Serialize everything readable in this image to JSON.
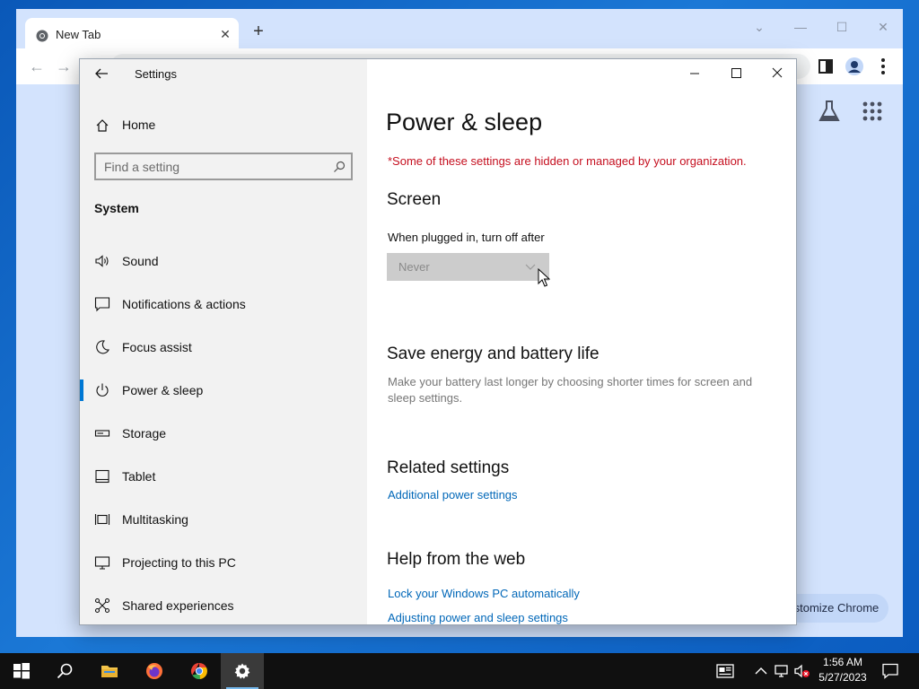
{
  "chrome": {
    "tab_title": "New Tab",
    "customize_label": "Customize Chrome"
  },
  "settings": {
    "app_title": "Settings",
    "home_label": "Home",
    "search_placeholder": "Find a setting",
    "section_title": "System",
    "nav_items": [
      {
        "label": "Sound",
        "icon": "speaker-icon"
      },
      {
        "label": "Notifications & actions",
        "icon": "notification-icon"
      },
      {
        "label": "Focus assist",
        "icon": "moon-icon"
      },
      {
        "label": "Power & sleep",
        "icon": "power-icon",
        "active": true
      },
      {
        "label": "Storage",
        "icon": "storage-icon"
      },
      {
        "label": "Tablet",
        "icon": "tablet-icon"
      },
      {
        "label": "Multitasking",
        "icon": "multitasking-icon"
      },
      {
        "label": "Projecting to this PC",
        "icon": "projecting-icon"
      },
      {
        "label": "Shared experiences",
        "icon": "shared-experiences-icon"
      }
    ],
    "page": {
      "title": "Power & sleep",
      "org_notice": "*Some of these settings are hidden or managed by your organization.",
      "screen_heading": "Screen",
      "plugged_in_label": "When plugged in, turn off after",
      "plugged_in_value": "Never",
      "save_energy_heading": "Save energy and battery life",
      "save_energy_desc": "Make your battery last longer by choosing shorter times for screen and sleep settings.",
      "related_heading": "Related settings",
      "related_link": "Additional power settings",
      "help_heading": "Help from the web",
      "help_links": [
        "Lock your Windows PC automatically",
        "Adjusting power and sleep settings"
      ]
    }
  },
  "taskbar": {
    "time": "1:56 AM",
    "date": "5/27/2023"
  },
  "colors": {
    "accent": "#0078d4",
    "link": "#0067b8",
    "warning": "#c50f1f"
  }
}
